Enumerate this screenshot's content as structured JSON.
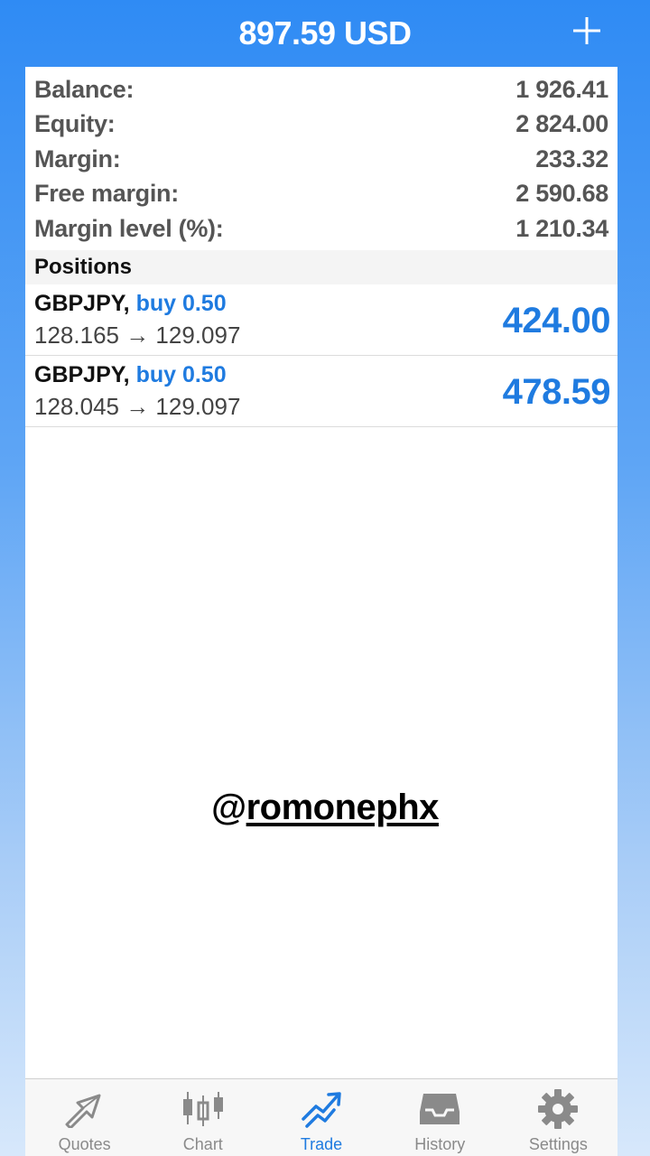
{
  "header": {
    "title": "897.59 USD",
    "add_icon": "plus-icon"
  },
  "summary": [
    {
      "label": "Balance:",
      "value": "1 926.41"
    },
    {
      "label": "Equity:",
      "value": "2 824.00"
    },
    {
      "label": "Margin:",
      "value": "233.32"
    },
    {
      "label": "Free margin:",
      "value": "2 590.68"
    },
    {
      "label": "Margin level (%):",
      "value": "1 210.34"
    }
  ],
  "positions": {
    "header": "Positions",
    "items": [
      {
        "symbol": "GBPJPY,",
        "side": "buy 0.50",
        "prices": "128.165 → 129.097",
        "profit": "424.00"
      },
      {
        "symbol": "GBPJPY,",
        "side": "buy 0.50",
        "prices": "128.045 → 129.097",
        "profit": "478.59"
      }
    ]
  },
  "watermark": {
    "at": "@",
    "handle": "romonephx"
  },
  "tabs": [
    {
      "label": "Quotes",
      "icon": "quotes-icon"
    },
    {
      "label": "Chart",
      "icon": "candlestick-chart-icon"
    },
    {
      "label": "Trade",
      "icon": "trade-icon",
      "active": true
    },
    {
      "label": "History",
      "icon": "inbox-icon"
    },
    {
      "label": "Settings",
      "icon": "gear-icon"
    }
  ],
  "colors": {
    "accent": "#1f7be0",
    "header_bg": "#2f8bf4",
    "tab_inactive": "#8a8a8a"
  }
}
